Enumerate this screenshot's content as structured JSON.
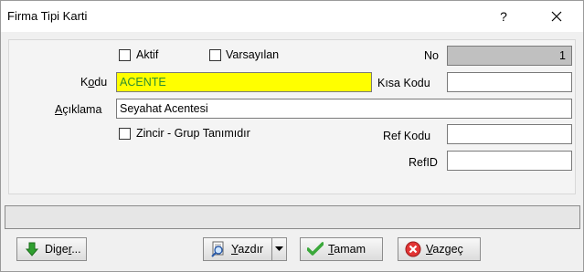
{
  "window": {
    "title": "Firma Tipi Karti",
    "help_glyph": "?"
  },
  "form": {
    "aktif_label": "Aktif",
    "varsayilan_label": "Varsayılan",
    "no_label": "No",
    "no_value": "1",
    "kodu_label_pre": "K",
    "kodu_label_mnemonic": "o",
    "kodu_label_post": "du",
    "kodu_value": "ACENTE",
    "kisa_kodu_label": "Kısa Kodu",
    "kisa_kodu_value": "",
    "aciklama_label_mnemonic": "A",
    "aciklama_label_post": "çıklama",
    "aciklama_value": "Seyahat Acentesi",
    "zincir_label": "Zincir - Grup Tanımıdır",
    "ref_kodu_label": "Ref Kodu",
    "ref_kodu_value": "",
    "refid_label": "RefID",
    "refid_value": ""
  },
  "status": {
    "text": ""
  },
  "buttons": {
    "diger_pre": "Dige",
    "diger_mnemonic": "r",
    "diger_post": "...",
    "yazdir_mnemonic": "Y",
    "yazdir_post": "azdır",
    "tamam_mnemonic": "T",
    "tamam_post": "amam",
    "vazgec_mnemonic": "V",
    "vazgec_post": "azgeç"
  },
  "icons": {
    "diger": "green-down-arrow-icon",
    "yazdir": "print-preview-icon",
    "tamam": "green-checkmark-icon",
    "vazgec": "red-x-circle-icon"
  }
}
